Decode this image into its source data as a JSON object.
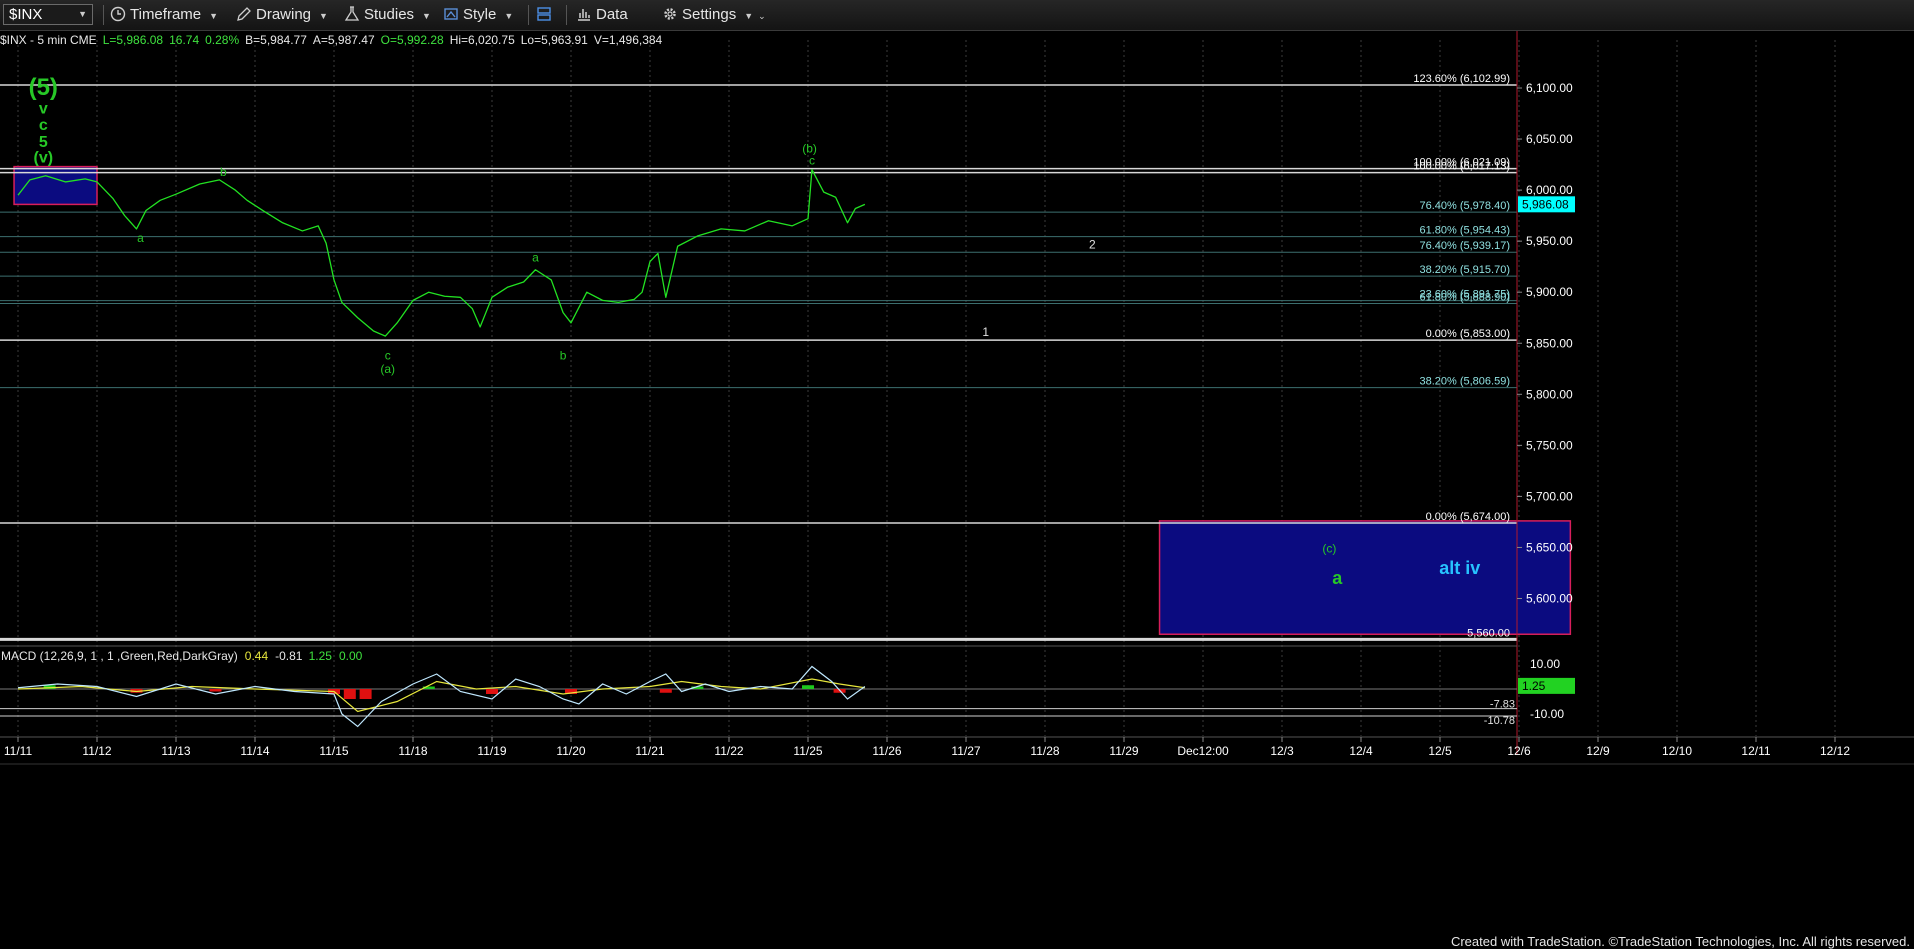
{
  "toolbar": {
    "symbol": "$INX",
    "timeframe": "Timeframe",
    "drawing": "Drawing",
    "studies": "Studies",
    "style": "Style",
    "data": "Data",
    "settings": "Settings"
  },
  "info": {
    "name": "$INX - 5 min  CME",
    "last": "L=5,986.08",
    "change": "16.74",
    "pct": "0.28%",
    "bid": "B=5,984.77",
    "ask": "A=5,987.47",
    "open": "O=5,992.28",
    "high": "Hi=6,020.75",
    "low": "Lo=5,963.91",
    "volume": "V=1,496,384"
  },
  "macd_label": {
    "name": "MACD (12,26,9, 1 , 1 ,Green,Red,DarkGray)",
    "v1": "0.44",
    "v2": "-0.81",
    "v3": "1.25",
    "v4": "0.00"
  },
  "footer": "Created with TradeStation. ©TradeStation Technologies, Inc. All rights reserved.",
  "colors": {
    "price": "#22e222",
    "wave_label": "#27c827",
    "fib_text": "#8fe0e0",
    "box_fill": "#0b0b80",
    "box_border": "#d81e5b",
    "axis_text": "#ffffff",
    "last_price_bg": "#00ffff",
    "macd_last_bg": "#22d222"
  },
  "chart_data": {
    "type": "line",
    "title": "",
    "symbol": "$INX",
    "interval": "5 min",
    "x_tick_labels": [
      "11/11",
      "11/12",
      "11/13",
      "11/14",
      "11/15",
      "11/18",
      "11/19",
      "11/20",
      "11/21",
      "11/22",
      "11/25",
      "11/26",
      "11/27",
      "11/28",
      "11/29",
      "Dec12:00",
      "12/3",
      "12/4",
      "12/5",
      "12/6",
      "12/9",
      "12/10",
      "12/11",
      "12/12"
    ],
    "y_ticks": [
      6100,
      6050,
      6000,
      5950,
      5900,
      5850,
      5800,
      5750,
      5700,
      5650,
      5600
    ],
    "y_tick_labels": [
      "6,100.00",
      "6,050.00",
      "6,000.00",
      "5,950.00",
      "5,900.00",
      "5,850.00",
      "5,800.00",
      "5,750.00",
      "5,700.00",
      "5,650.00",
      "5,600.00"
    ],
    "ylim": [
      5563,
      6150
    ],
    "last_price": 5986.08,
    "last_price_label": "5,986.08",
    "series": [
      {
        "points": [
          [
            0,
            5995
          ],
          [
            0.15,
            6010
          ],
          [
            0.35,
            6014
          ],
          [
            0.6,
            6008
          ],
          [
            0.85,
            6011
          ],
          [
            1.0,
            6008
          ],
          [
            1.2,
            5992
          ],
          [
            1.35,
            5975
          ],
          [
            1.5,
            5962
          ],
          [
            1.62,
            5980
          ],
          [
            1.8,
            5990
          ],
          [
            2.0,
            5996
          ],
          [
            2.3,
            6006
          ],
          [
            2.55,
            6010
          ],
          [
            2.75,
            6000
          ],
          [
            2.9,
            5990
          ],
          [
            3.1,
            5980
          ],
          [
            3.35,
            5968
          ],
          [
            3.6,
            5960
          ],
          [
            3.8,
            5965
          ],
          [
            3.9,
            5948
          ],
          [
            4.0,
            5912
          ],
          [
            4.1,
            5890
          ],
          [
            4.3,
            5875
          ],
          [
            4.5,
            5862
          ],
          [
            4.65,
            5857
          ],
          [
            4.8,
            5870
          ],
          [
            5.0,
            5892
          ],
          [
            5.2,
            5900
          ],
          [
            5.4,
            5896
          ],
          [
            5.6,
            5895
          ],
          [
            5.75,
            5884
          ],
          [
            5.85,
            5866
          ],
          [
            6.0,
            5895
          ],
          [
            6.2,
            5905
          ],
          [
            6.4,
            5910
          ],
          [
            6.55,
            5922
          ],
          [
            6.75,
            5912
          ],
          [
            6.9,
            5880
          ],
          [
            7.0,
            5870
          ],
          [
            7.2,
            5900
          ],
          [
            7.4,
            5892
          ],
          [
            7.6,
            5890
          ],
          [
            7.8,
            5893
          ],
          [
            7.9,
            5900
          ],
          [
            8.0,
            5930
          ],
          [
            8.1,
            5938
          ],
          [
            8.2,
            5895
          ],
          [
            8.35,
            5945
          ],
          [
            8.6,
            5955
          ],
          [
            8.9,
            5962
          ],
          [
            9.2,
            5960
          ],
          [
            9.5,
            5970
          ],
          [
            9.8,
            5965
          ],
          [
            10.0,
            5972
          ],
          [
            10.05,
            6020
          ],
          [
            10.2,
            5998
          ],
          [
            10.35,
            5993
          ],
          [
            10.5,
            5968
          ],
          [
            10.6,
            5982
          ],
          [
            10.72,
            5986
          ]
        ]
      }
    ],
    "fib_levels": [
      {
        "label": "123.60% (6,102.99)",
        "value": 6102.99
      },
      {
        "label": "100.00% (6,021.09)",
        "value": 6021.09
      },
      {
        "label": "100.00% (6,017.13)",
        "value": 6017.13
      },
      {
        "label": "76.40% (5,978.40)",
        "value": 5978.4
      },
      {
        "label": "61.80% (5,954.43)",
        "value": 5954.43
      },
      {
        "label": "76.40% (5,939.17)",
        "value": 5939.17
      },
      {
        "label": "38.20% (5,915.70)",
        "value": 5915.7
      },
      {
        "label": "23.60% (5,891.75)",
        "value": 5891.75
      },
      {
        "label": "61.80% (5,888.90)",
        "value": 5888.9
      },
      {
        "label": "0.00% (5,853.00)",
        "value": 5853.0
      },
      {
        "label": "38.20% (5,806.59)",
        "value": 5806.59
      },
      {
        "label": "0.00% (5,674.00)",
        "value": 5674.0
      },
      {
        "label": "5,560.00",
        "value": 5560.0
      }
    ],
    "target_boxes": [
      {
        "x_start": -0.05,
        "x_end": 1.0,
        "y_low": 5986,
        "y_high": 6023
      },
      {
        "x_start": 14.45,
        "x_end": 19.65,
        "y_low": 5565,
        "y_high": 5676
      }
    ],
    "wave_labels": [
      {
        "text": "(5)",
        "x": 0.32,
        "price": 6093
      },
      {
        "text": "v",
        "x": 0.32,
        "price": 6075
      },
      {
        "text": "c",
        "x": 0.32,
        "price": 6059
      },
      {
        "text": "5",
        "x": 0.32,
        "price": 6042
      },
      {
        "text": "(v)",
        "x": 0.32,
        "price": 6027
      },
      {
        "text": "b",
        "x": 2.6,
        "price": 6014
      },
      {
        "text": "a",
        "x": 1.55,
        "price": 5949
      },
      {
        "text": "c",
        "x": 4.68,
        "price": 5834
      },
      {
        "text": "(a)",
        "x": 4.68,
        "price": 5821
      },
      {
        "text": "a",
        "x": 6.55,
        "price": 5930
      },
      {
        "text": "b",
        "x": 6.9,
        "price": 5834
      },
      {
        "text": "(b)",
        "x": 10.02,
        "price": 6037
      },
      {
        "text": "c",
        "x": 10.05,
        "price": 6025
      },
      {
        "text": "2",
        "x": 13.6,
        "price": 5943
      },
      {
        "text": "1",
        "x": 12.25,
        "price": 5857
      },
      {
        "text": "(c)",
        "x": 16.6,
        "price": 5645
      },
      {
        "text": "a",
        "x": 16.7,
        "price": 5614
      },
      {
        "text": "alt iv",
        "x": 18.25,
        "price": 5624
      }
    ]
  },
  "macd_data": {
    "y_tick_labels": [
      "10.00",
      "-10.00"
    ],
    "y_ticks": [
      10,
      -10
    ],
    "ylim": [
      -20,
      15
    ],
    "last_value_label": "1.25",
    "levels": [
      {
        "label": "-7.83",
        "value": -7.83
      },
      {
        "label": "-10.78",
        "value": -10.78
      }
    ],
    "macd": [
      [
        0,
        0.5
      ],
      [
        0.5,
        2
      ],
      [
        1.0,
        1
      ],
      [
        1.5,
        -3
      ],
      [
        2.0,
        2
      ],
      [
        2.5,
        -2
      ],
      [
        3.0,
        1
      ],
      [
        3.5,
        -1
      ],
      [
        4.0,
        -2
      ],
      [
        4.1,
        -10
      ],
      [
        4.3,
        -15
      ],
      [
        4.6,
        -5
      ],
      [
        5.0,
        2
      ],
      [
        5.3,
        6
      ],
      [
        5.6,
        -1
      ],
      [
        6.0,
        -4
      ],
      [
        6.3,
        4
      ],
      [
        6.6,
        1
      ],
      [
        6.9,
        -4
      ],
      [
        7.1,
        -6
      ],
      [
        7.4,
        2
      ],
      [
        7.7,
        -2
      ],
      [
        8.0,
        3
      ],
      [
        8.2,
        6
      ],
      [
        8.4,
        -1
      ],
      [
        8.7,
        2
      ],
      [
        9.0,
        -1
      ],
      [
        9.4,
        1
      ],
      [
        9.8,
        0
      ],
      [
        10.05,
        9
      ],
      [
        10.3,
        3
      ],
      [
        10.5,
        -4
      ],
      [
        10.72,
        1
      ]
    ],
    "signal": [
      [
        0,
        0
      ],
      [
        0.8,
        1
      ],
      [
        1.5,
        -1
      ],
      [
        2.2,
        1
      ],
      [
        3.0,
        0
      ],
      [
        4.0,
        -1
      ],
      [
        4.3,
        -9
      ],
      [
        4.8,
        -5
      ],
      [
        5.3,
        3
      ],
      [
        5.8,
        0
      ],
      [
        6.3,
        1
      ],
      [
        6.9,
        -2
      ],
      [
        7.4,
        0
      ],
      [
        8.0,
        1
      ],
      [
        8.4,
        3
      ],
      [
        8.9,
        1
      ],
      [
        9.4,
        0
      ],
      [
        10.05,
        4
      ],
      [
        10.4,
        2
      ],
      [
        10.72,
        0.5
      ]
    ],
    "histogram": [
      [
        0.4,
        1.5
      ],
      [
        1.5,
        -1.5
      ],
      [
        2.5,
        -1
      ],
      [
        4.0,
        -2
      ],
      [
        4.2,
        -4
      ],
      [
        4.4,
        -4
      ],
      [
        5.2,
        1
      ],
      [
        6.0,
        -2
      ],
      [
        7.0,
        -2
      ],
      [
        8.2,
        -1.5
      ],
      [
        8.6,
        1
      ],
      [
        10.0,
        1.5
      ],
      [
        10.4,
        -1.5
      ]
    ]
  }
}
